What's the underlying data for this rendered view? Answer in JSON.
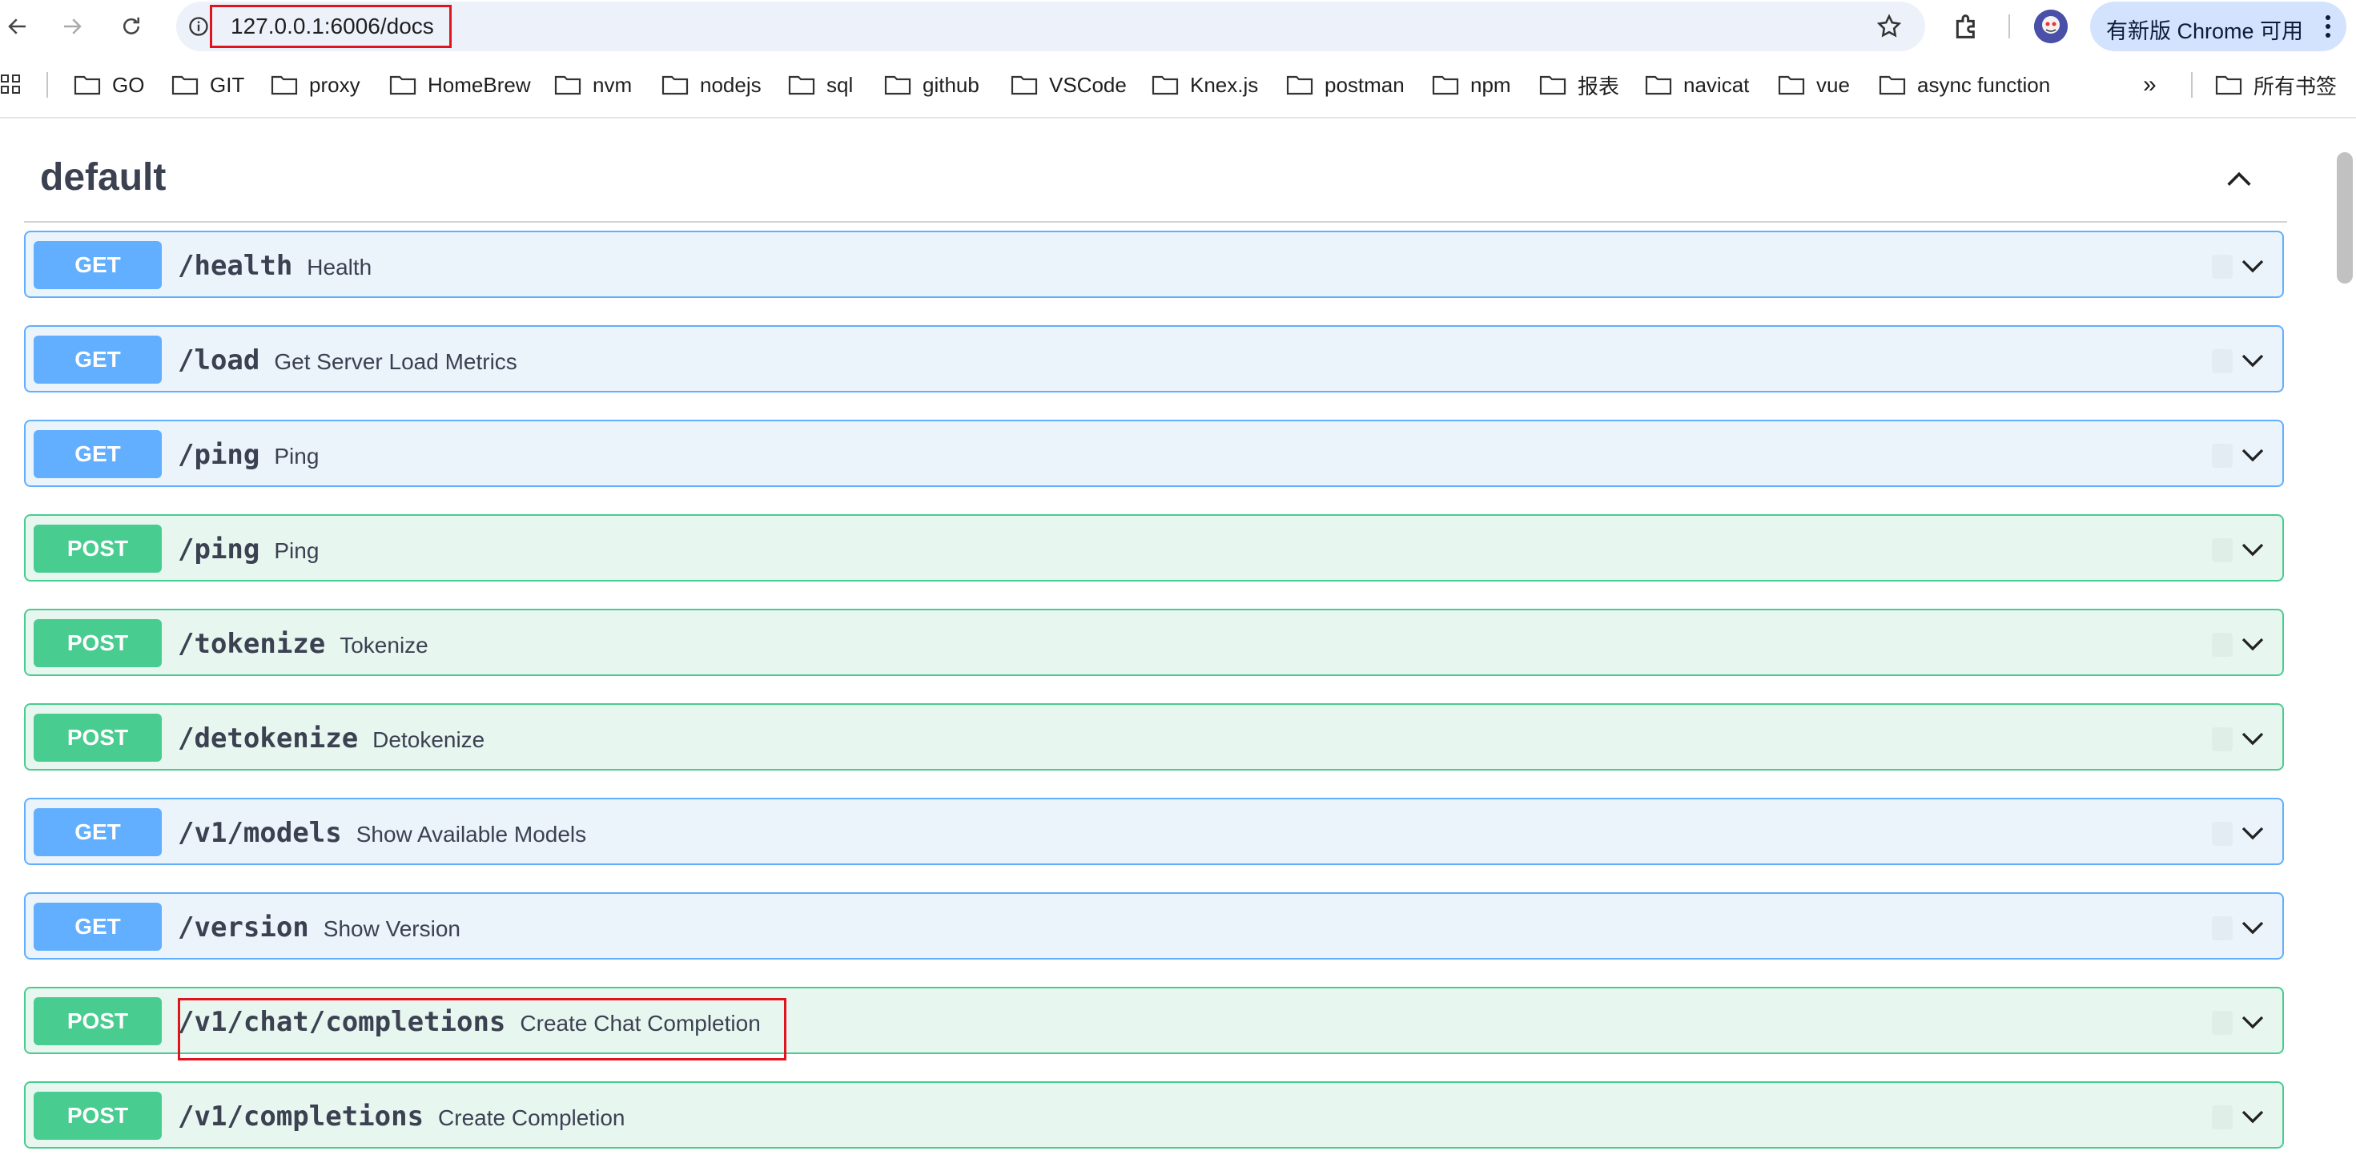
{
  "browser": {
    "url": "127.0.0.1:6006/docs",
    "update_button": "有新版 Chrome 可用",
    "icons": [
      "back-icon",
      "forward-icon",
      "reload-icon",
      "site-info-icon",
      "bookmark-star-icon",
      "extensions-icon",
      "profile-avatar",
      "menu-dots-icon",
      "apps-grid-icon",
      "folder-icon",
      "more-bookmarks-icon"
    ]
  },
  "bookmarks": {
    "items": [
      "GO",
      "GIT",
      "proxy",
      "HomeBrew",
      "nvm",
      "nodejs",
      "sql",
      "github",
      "VSCode",
      "Knex.js",
      "postman",
      "npm",
      "报表",
      "navicat",
      "vue",
      "async function"
    ],
    "more": "»",
    "all_bookmarks": "所有书签"
  },
  "section": {
    "title": "default"
  },
  "operations": [
    {
      "method": "GET",
      "path": "/health",
      "summary": "Health"
    },
    {
      "method": "GET",
      "path": "/load",
      "summary": "Get Server Load Metrics"
    },
    {
      "method": "GET",
      "path": "/ping",
      "summary": "Ping"
    },
    {
      "method": "POST",
      "path": "/ping",
      "summary": "Ping"
    },
    {
      "method": "POST",
      "path": "/tokenize",
      "summary": "Tokenize"
    },
    {
      "method": "POST",
      "path": "/detokenize",
      "summary": "Detokenize"
    },
    {
      "method": "GET",
      "path": "/v1/models",
      "summary": "Show Available Models"
    },
    {
      "method": "GET",
      "path": "/version",
      "summary": "Show Version"
    },
    {
      "method": "POST",
      "path": "/v1/chat/completions",
      "summary": "Create Chat Completion"
    },
    {
      "method": "POST",
      "path": "/v1/completions",
      "summary": "Create Completion"
    }
  ],
  "colors": {
    "get": "#61affe",
    "post": "#49cc90",
    "highlight": "#e0141e"
  }
}
